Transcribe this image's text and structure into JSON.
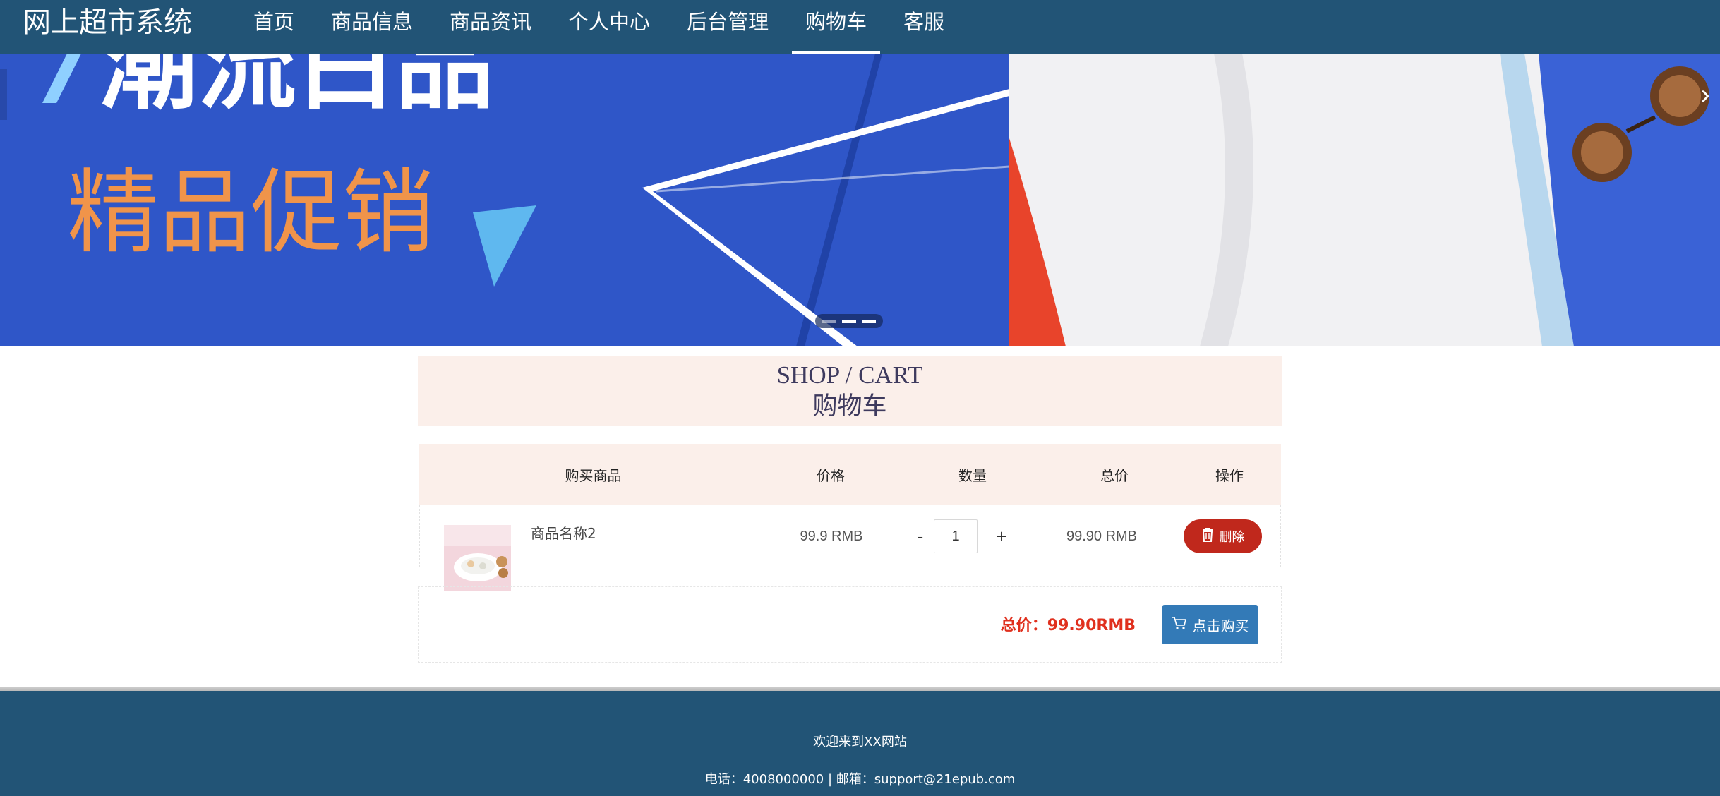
{
  "header": {
    "site_title": "网上超市系统",
    "nav": [
      {
        "label": "首页",
        "active": false
      },
      {
        "label": "商品信息",
        "active": false
      },
      {
        "label": "商品资讯",
        "active": false
      },
      {
        "label": "个人中心",
        "active": false
      },
      {
        "label": "后台管理",
        "active": false
      },
      {
        "label": "购物车",
        "active": true
      },
      {
        "label": "客服",
        "active": false
      }
    ]
  },
  "banner": {
    "headline": "精品促销",
    "top_text": "潮流白品",
    "slides": 3,
    "active_slide": 2,
    "next_icon": "chevron-right-icon"
  },
  "page_title": {
    "en": "SHOP / CART",
    "cn": "购物车"
  },
  "cart": {
    "columns": [
      "购买商品",
      "价格",
      "数量",
      "总价",
      "操作"
    ],
    "items": [
      {
        "name": "商品名称2",
        "price": "99.9 RMB",
        "quantity": "1",
        "total": "99.90 RMB",
        "delete_label": "删除"
      }
    ],
    "qty_minus": "-",
    "qty_plus": "+",
    "total_label": "总价：99.90RMB",
    "buy_label": "点击购买",
    "buy_icon": "cart-icon",
    "delete_icon": "trash-icon"
  },
  "footer": {
    "welcome": "欢迎来到XX网站",
    "contact": "电话：4008000000 | 邮箱：support@21epub.com"
  },
  "colors": {
    "header_bg": "#225476",
    "accent_red": "#c0281c",
    "total_red": "#e0301e",
    "buy_blue": "#337ab7",
    "title_panel_bg": "#fbefea"
  }
}
